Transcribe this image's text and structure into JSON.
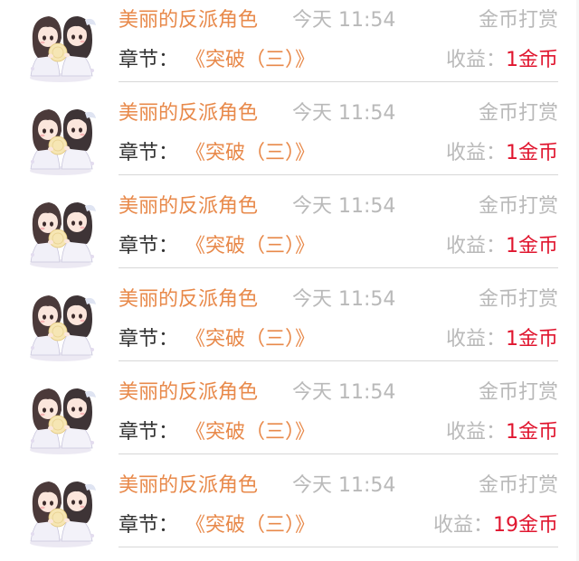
{
  "records": [
    {
      "book_title": "美丽的反派角色",
      "time": "今天 11:54",
      "type": "金币打赏",
      "chapter_label": "章节：",
      "chapter_name": "《突破（三）》",
      "income_label": "收益：",
      "income_value": "1金币"
    },
    {
      "book_title": "美丽的反派角色",
      "time": "今天 11:54",
      "type": "金币打赏",
      "chapter_label": "章节：",
      "chapter_name": "《突破（三）》",
      "income_label": "收益：",
      "income_value": "1金币"
    },
    {
      "book_title": "美丽的反派角色",
      "time": "今天 11:54",
      "type": "金币打赏",
      "chapter_label": "章节：",
      "chapter_name": "《突破（三）》",
      "income_label": "收益：",
      "income_value": "1金币"
    },
    {
      "book_title": "美丽的反派角色",
      "time": "今天 11:54",
      "type": "金币打赏",
      "chapter_label": "章节：",
      "chapter_name": "《突破（三）》",
      "income_label": "收益：",
      "income_value": "1金币"
    },
    {
      "book_title": "美丽的反派角色",
      "time": "今天 11:54",
      "type": "金币打赏",
      "chapter_label": "章节：",
      "chapter_name": "《突破（三）》",
      "income_label": "收益：",
      "income_value": "1金币"
    },
    {
      "book_title": "美丽的反派角色",
      "time": "今天 11:54",
      "type": "金币打赏",
      "chapter_label": "章节：",
      "chapter_name": "《突破（三）》",
      "income_label": "收益：",
      "income_value": "19金币"
    }
  ],
  "colors": {
    "title": "#e8894a",
    "meta": "#b9b9b9",
    "label": "#333333",
    "income": "#e0162f",
    "divider": "#d7d7d7"
  },
  "icons": {
    "avatar": "chibi-couple-avatar-icon"
  }
}
